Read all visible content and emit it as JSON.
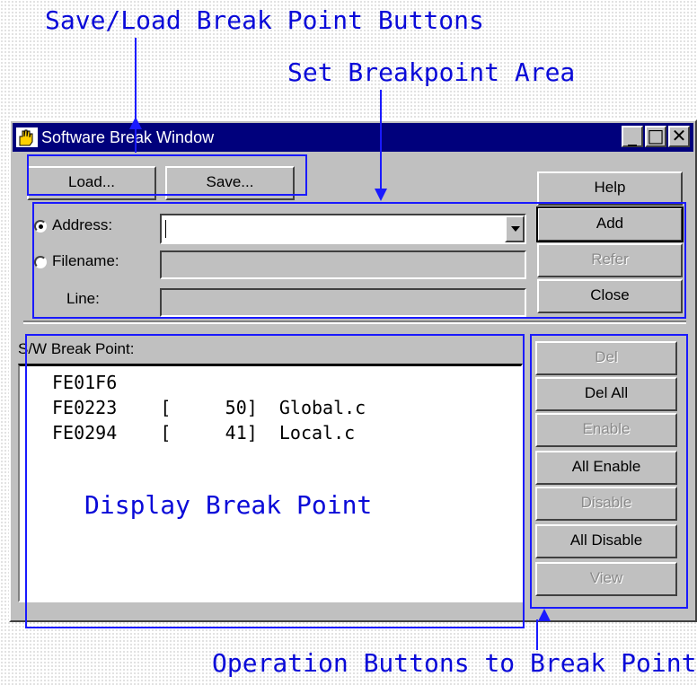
{
  "annotations": {
    "save_load": "Save/Load Break Point Buttons",
    "set_area": "Set Breakpoint Area",
    "display": "Display Break Point",
    "operation": "Operation Buttons to Break Points"
  },
  "window": {
    "title": "Software Break Window",
    "controls": {
      "minimize": "_",
      "maximize": "□",
      "close": "✕"
    }
  },
  "top_buttons": {
    "load": "Load...",
    "save": "Save..."
  },
  "form": {
    "address_label": "Address:",
    "filename_label": "Filename:",
    "line_label": "Line:",
    "address_value": "",
    "selected": "Address"
  },
  "side_buttons": {
    "help": "Help",
    "add": "Add",
    "refer": "Refer",
    "close": "Close"
  },
  "list": {
    "header": "S/W Break Point:",
    "rows": [
      "FE01F6",
      "FE0223    [     50]  Global.c",
      "FE0294    [     41]  Local.c"
    ]
  },
  "ops": {
    "del": "Del",
    "del_all": "Del All",
    "enable": "Enable",
    "all_enable": "All Enable",
    "disable": "Disable",
    "all_disable": "All Disable",
    "view": "View"
  },
  "colors": {
    "annotation": "#1a1aff",
    "titlebar": "#00007c",
    "face": "#c0c0c0"
  }
}
